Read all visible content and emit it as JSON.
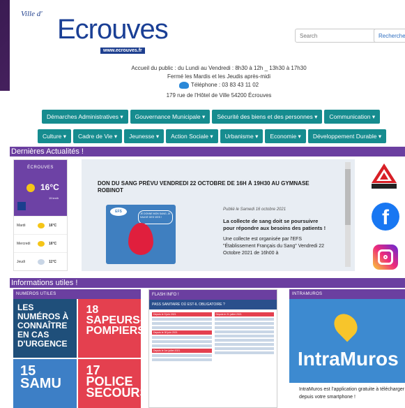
{
  "header": {
    "logo_ville": "Ville d'",
    "logo_name": "Ecrouves",
    "logo_url": "www.ecrouves.fr",
    "search_placeholder": "Search",
    "search_button": "Recherche",
    "hours": "Accueil du public : du Lundi au Vendredi : 8h30 à 12h _ 13h30 à 17h30",
    "closed": "Fermé les Mardis et les Jeudis après-midi",
    "phone": "Téléphone : 03 83 43 11 02",
    "address": "179 rue de l'Hôtel de Ville 54200 Écrouves"
  },
  "nav": {
    "row1": [
      "Démarches Administratives ▾",
      "Gouvernance Municipale ▾",
      "Sécurité des biens et des personnes ▾",
      "Communication ▾"
    ],
    "row2": [
      "Culture ▾",
      "Cadre de Vie ▾",
      "Jeunesse ▾",
      "Action Sociale ▾",
      "Urbanisme ▾",
      "Economie ▾",
      "Développement Durable ▾"
    ]
  },
  "sections": {
    "actualites": "Dernières Actualités !",
    "infos": "Informations utiles !"
  },
  "meteo": {
    "city": "ÉCROUVES",
    "temp": "16°C",
    "wind": "15 km/h",
    "days": [
      {
        "day": "Mardi",
        "temp": "16°C",
        "icon": "sun-icon"
      },
      {
        "day": "Mercredi",
        "temp": "16°C",
        "icon": "sun-icon"
      },
      {
        "day": "Jeudi",
        "temp": "11°C",
        "icon": "cloud-icon"
      }
    ]
  },
  "actu": {
    "title": "DON DU SANG PRÉVU VENDREDI 22 OCTOBRE DE 16H À 19H30 AU GYMNASE ROBINOT",
    "efs_label": "EFS",
    "efs_bubble": "JE DONNE MON SANG, JE SAUVE DES VIES !",
    "published": "Publié le Samedi 16 octobre 2021",
    "lead": "La collecte de sang doit se poursuivre pour répondre aux besoins des patients !",
    "body": "Une collecte est organisée par l'EFS \"Établissement Français du Sang\" Vendredi 22 Octobre 2021 de 16h00 à"
  },
  "numeros": {
    "header": "NUMEROS UTILES",
    "tile1": "LES NUMÉROS À CONNAÎTRE EN CAS D'URGENCE",
    "tile2": "18 SAPEURS-POMPIERS",
    "tile3": "15 SAMU",
    "tile4": "17 POLICE SECOURS"
  },
  "flash": {
    "header": "FLASH INFO !",
    "pass": "PASS SANITAIRE OÙ EST-IL OBLIGATOIRE ?",
    "tag1": "Depuis le 9 juin 2021",
    "tag2": "Depuis le 21 juillet 2021",
    "tag3": "Depuis le 30 juin 2021",
    "tag4": "Depuis le 1er juillet 2021"
  },
  "intramuros": {
    "header": "INTRAMUROS",
    "name": "IntraMuros",
    "text": "IntraMuros est l'application gratuite à télécharger depuis votre smartphone !"
  }
}
